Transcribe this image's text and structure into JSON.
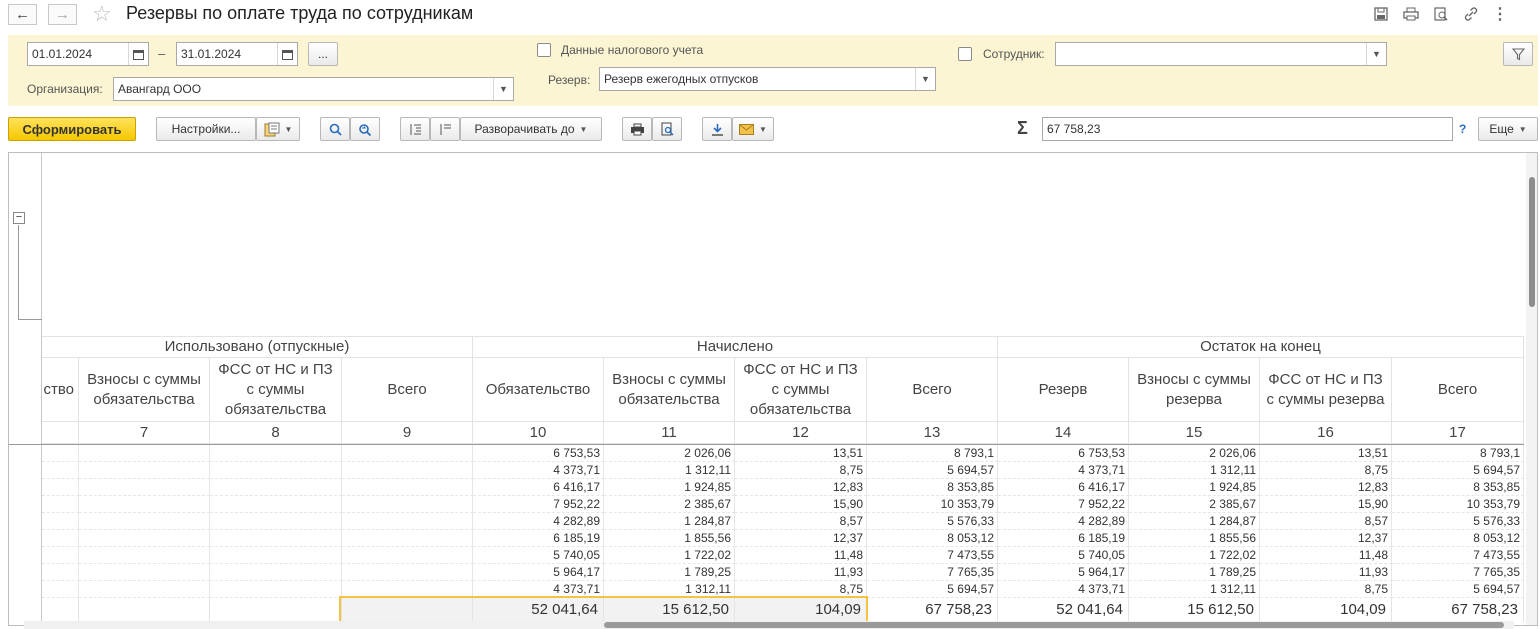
{
  "window": {
    "title": "Резервы по оплате труда по сотрудникам"
  },
  "filters": {
    "date_from": "01.01.2024",
    "date_sep": "–",
    "date_to": "31.01.2024",
    "period_btn": "...",
    "tax_checkbox_label": "Данные налогового учета",
    "employee_label": "Сотрудник:",
    "employee_value": "",
    "org_label": "Организация:",
    "org_value": "Авангард ООО",
    "reserve_label": "Резерв:",
    "reserve_value": "Резерв ежегодных отпусков"
  },
  "toolbar": {
    "generate": "Сформировать",
    "settings": "Настройки...",
    "expand_to": "Разворачивать до",
    "sum_symbol": "Σ",
    "sum_value": "67 758,23",
    "help": "?",
    "more": "Еще"
  },
  "table": {
    "groups": [
      "Использовано (отпускные)",
      "Начислено",
      "Остаток на конец"
    ],
    "columns": [
      {
        "label": "ство",
        "num": ""
      },
      {
        "label": "Взносы с суммы обязательства",
        "num": "7"
      },
      {
        "label": "ФСС от НС и ПЗ с суммы обязательства",
        "num": "8"
      },
      {
        "label": "Всего",
        "num": "9"
      },
      {
        "label": "Обязательство",
        "num": "10"
      },
      {
        "label": "Взносы с суммы обязательства",
        "num": "11"
      },
      {
        "label": "ФСС от НС и ПЗ с суммы обязательства",
        "num": "12"
      },
      {
        "label": "Всего",
        "num": "13"
      },
      {
        "label": "Резерв",
        "num": "14"
      },
      {
        "label": "Взносы с суммы резерва",
        "num": "15"
      },
      {
        "label": "ФСС от НС и ПЗ с суммы резерва",
        "num": "16"
      },
      {
        "label": "Всего",
        "num": "17"
      }
    ],
    "rows": [
      [
        "",
        "",
        "",
        "",
        "6 753,53",
        "2 026,06",
        "13,51",
        "8 793,1",
        "6 753,53",
        "2 026,06",
        "13,51",
        "8 793,1"
      ],
      [
        "",
        "",
        "",
        "",
        "4 373,71",
        "1 312,11",
        "8,75",
        "5 694,57",
        "4 373,71",
        "1 312,11",
        "8,75",
        "5 694,57"
      ],
      [
        "",
        "",
        "",
        "",
        "6 416,17",
        "1 924,85",
        "12,83",
        "8 353,85",
        "6 416,17",
        "1 924,85",
        "12,83",
        "8 353,85"
      ],
      [
        "",
        "",
        "",
        "",
        "7 952,22",
        "2 385,67",
        "15,90",
        "10 353,79",
        "7 952,22",
        "2 385,67",
        "15,90",
        "10 353,79"
      ],
      [
        "",
        "",
        "",
        "",
        "4 282,89",
        "1 284,87",
        "8,57",
        "5 576,33",
        "4 282,89",
        "1 284,87",
        "8,57",
        "5 576,33"
      ],
      [
        "",
        "",
        "",
        "",
        "6 185,19",
        "1 855,56",
        "12,37",
        "8 053,12",
        "6 185,19",
        "1 855,56",
        "12,37",
        "8 053,12"
      ],
      [
        "",
        "",
        "",
        "",
        "5 740,05",
        "1 722,02",
        "11,48",
        "7 473,55",
        "5 740,05",
        "1 722,02",
        "11,48",
        "7 473,55"
      ],
      [
        "",
        "",
        "",
        "",
        "5 964,17",
        "1 789,25",
        "11,93",
        "7 765,35",
        "5 964,17",
        "1 789,25",
        "11,93",
        "7 765,35"
      ],
      [
        "",
        "",
        "",
        "",
        "4 373,71",
        "1 312,11",
        "8,75",
        "5 694,57",
        "4 373,71",
        "1 312,11",
        "8,75",
        "5 694,57"
      ]
    ],
    "totals": [
      "",
      "",
      "",
      "",
      "52 041,64",
      "15 612,50",
      "104,09",
      "67 758,23",
      "52 041,64",
      "15 612,50",
      "104,09",
      "67 758,23"
    ]
  },
  "colors": {
    "filter_bg": "#fbf5d3",
    "primary_button": "#f5c800",
    "selection": "#f5c343"
  }
}
